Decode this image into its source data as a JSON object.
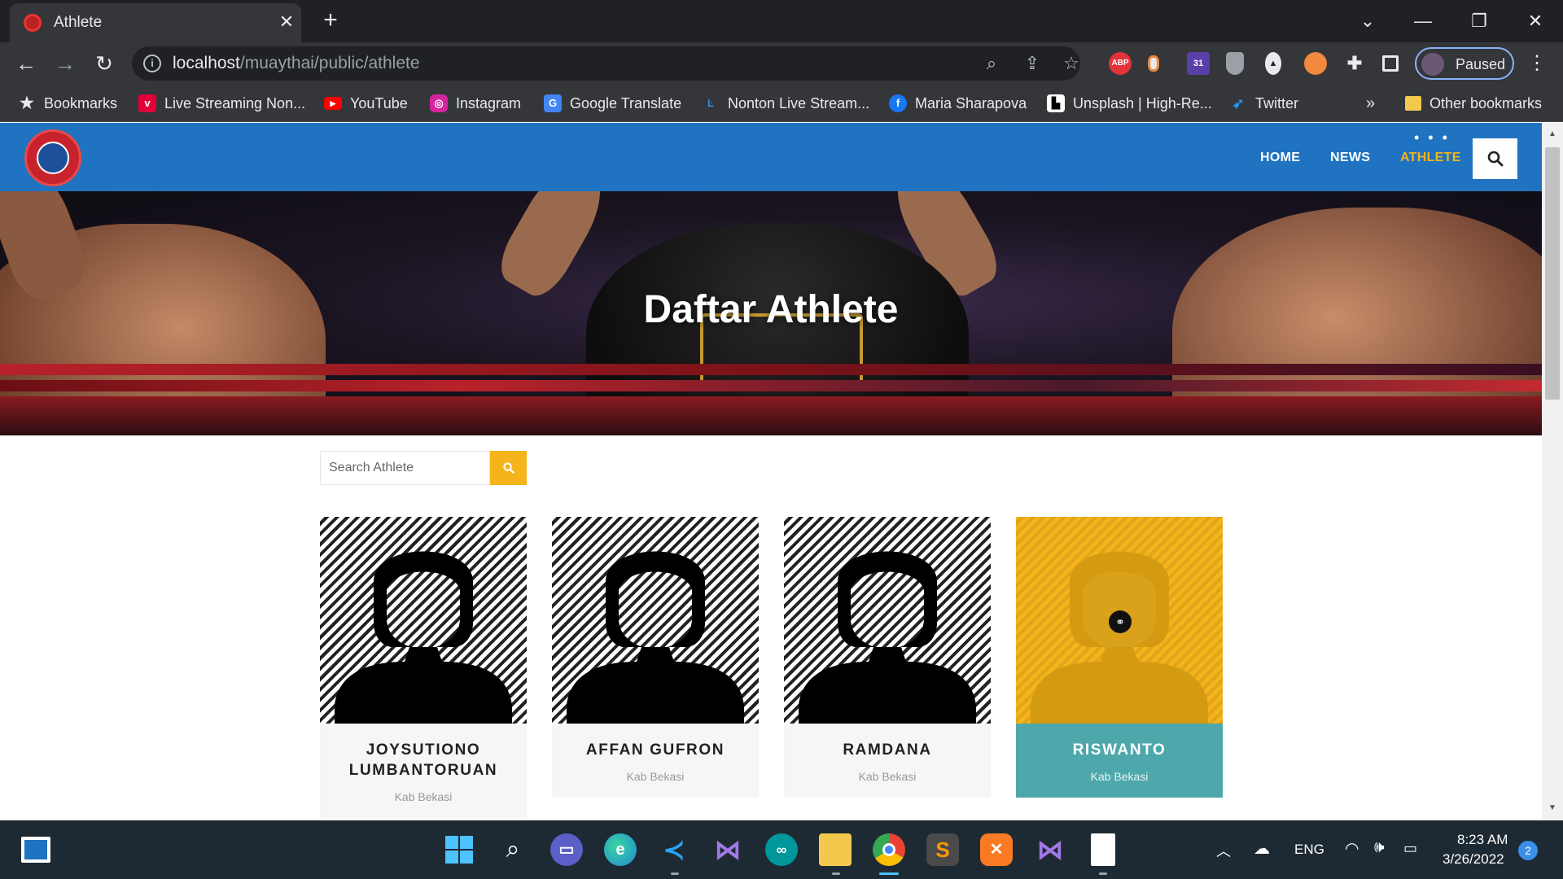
{
  "browser": {
    "tab": {
      "title": "Athlete",
      "close_glyph": "✕"
    },
    "new_tab_glyph": "+",
    "window_controls": [
      "⌄",
      "—",
      "❐",
      "✕"
    ],
    "url": {
      "host": "localhost",
      "path": "/muaythai/public/athlete"
    },
    "extensions": [
      "ABP",
      "31"
    ],
    "profile_label": "Paused",
    "bookmarks": [
      {
        "label": "Bookmarks",
        "icon": "star-icon"
      },
      {
        "label": "Live Streaming Non...",
        "icon": "vidio-icon"
      },
      {
        "label": "YouTube",
        "icon": "youtube-icon"
      },
      {
        "label": "Instagram",
        "icon": "instagram-icon"
      },
      {
        "label": "Google Translate",
        "icon": "google-translate-icon"
      },
      {
        "label": "Nonton Live Stream...",
        "icon": "stream-icon"
      },
      {
        "label": "Maria Sharapova",
        "icon": "facebook-icon"
      },
      {
        "label": "Unsplash | High-Re...",
        "icon": "unsplash-icon"
      },
      {
        "label": "Twitter",
        "icon": "twitter-icon"
      }
    ],
    "bookmarks_overflow": "»",
    "other_bookmarks": "Other bookmarks"
  },
  "site": {
    "menu": [
      {
        "label": "HOME",
        "active": false
      },
      {
        "label": "NEWS",
        "active": false
      },
      {
        "label": "ATHLETE",
        "active": true
      }
    ],
    "hero_title": "Daftar Athlete",
    "search_placeholder": "Search Athlete",
    "athletes": [
      {
        "name": "JOYSUTIONO LUMBANTORUAN",
        "location": "Kab Bekasi"
      },
      {
        "name": "AFFAN GUFRON",
        "location": "Kab Bekasi"
      },
      {
        "name": "RAMDANA",
        "location": "Kab Bekasi"
      },
      {
        "name": "RISWANTO",
        "location": "Kab Bekasi"
      }
    ],
    "colors": {
      "header": "#1f73c0",
      "accent": "#f4b41a",
      "hover_card": "#4ea8ab"
    }
  },
  "taskbar": {
    "apps": [
      "start",
      "search",
      "teams",
      "edge",
      "vscode",
      "visual-studio",
      "arduino",
      "file-explorer",
      "chrome",
      "sublime",
      "xampp",
      "visual-studio-2",
      "notepad"
    ],
    "language": "ENG",
    "time": "8:23 AM",
    "date": "3/26/2022",
    "notification_count": "2"
  }
}
